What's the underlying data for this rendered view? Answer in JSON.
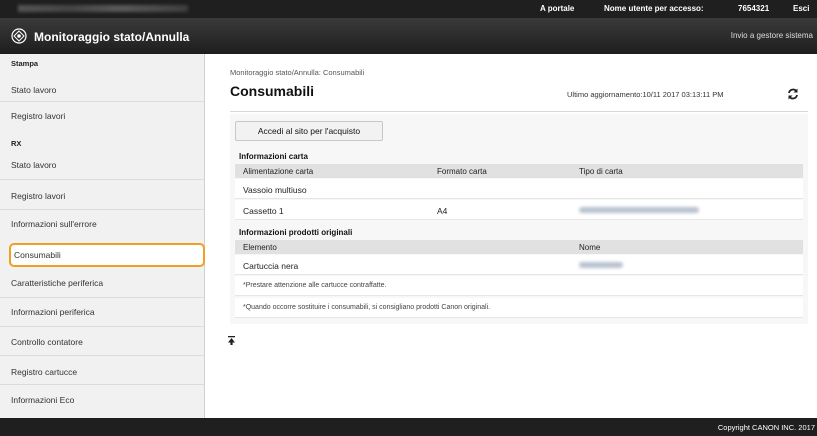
{
  "topbar": {
    "portal": "A portale",
    "user_label": "Nome utente per accesso:",
    "user_id": "7654321",
    "logout": "Esci"
  },
  "header": {
    "title": "Monitoraggio stato/Annulla",
    "send_link": "Invio a gestore sistema"
  },
  "sidebar": {
    "sections": [
      {
        "title": "Stampa",
        "items": [
          "Stato lavoro",
          "Registro lavori"
        ]
      },
      {
        "title": "RX",
        "items": [
          "Stato lavoro",
          "Registro lavori",
          "Informazioni sull'errore",
          "Consumabili",
          "Caratteristiche periferica",
          "Informazioni periferica",
          "Controllo contatore",
          "Registro cartucce",
          "Informazioni Eco"
        ]
      }
    ],
    "active_item": "Consumabili"
  },
  "main": {
    "breadcrumb": "Monitoraggio stato/Annulla: Consumabili",
    "title": "Consumabili",
    "last_update": "Ultimo aggiornamento:10/11 2017 03:13:11 PM",
    "buy_button": "Accedi al sito per l'acquisto",
    "paper": {
      "heading": "Informazioni carta",
      "columns": [
        "Alimentazione carta",
        "Formato carta",
        "Tipo di carta"
      ],
      "rows": [
        {
          "source": "Vassoio multiuso",
          "size": "",
          "type": ""
        },
        {
          "source": "Cassetto 1",
          "size": "A4",
          "type": ""
        }
      ]
    },
    "originals": {
      "heading": "Informazioni prodotti originali",
      "columns": [
        "Elemento",
        "Nome"
      ],
      "rows": [
        {
          "item": "Cartuccia nera",
          "name": ""
        }
      ]
    },
    "notes": [
      "*Prestare attenzione alle cartucce contraffatte.",
      "*Quando occorre sostituire i consumabili, si consigliano prodotti Canon originali."
    ]
  },
  "footer": {
    "copyright": "Copyright CANON INC. 2017"
  },
  "colors": {
    "topbar": "#1f1f1f",
    "active_highlight": "#f0a020",
    "sidebar_bg": "#f1f1f1",
    "table_header": "#e1e1e1"
  }
}
